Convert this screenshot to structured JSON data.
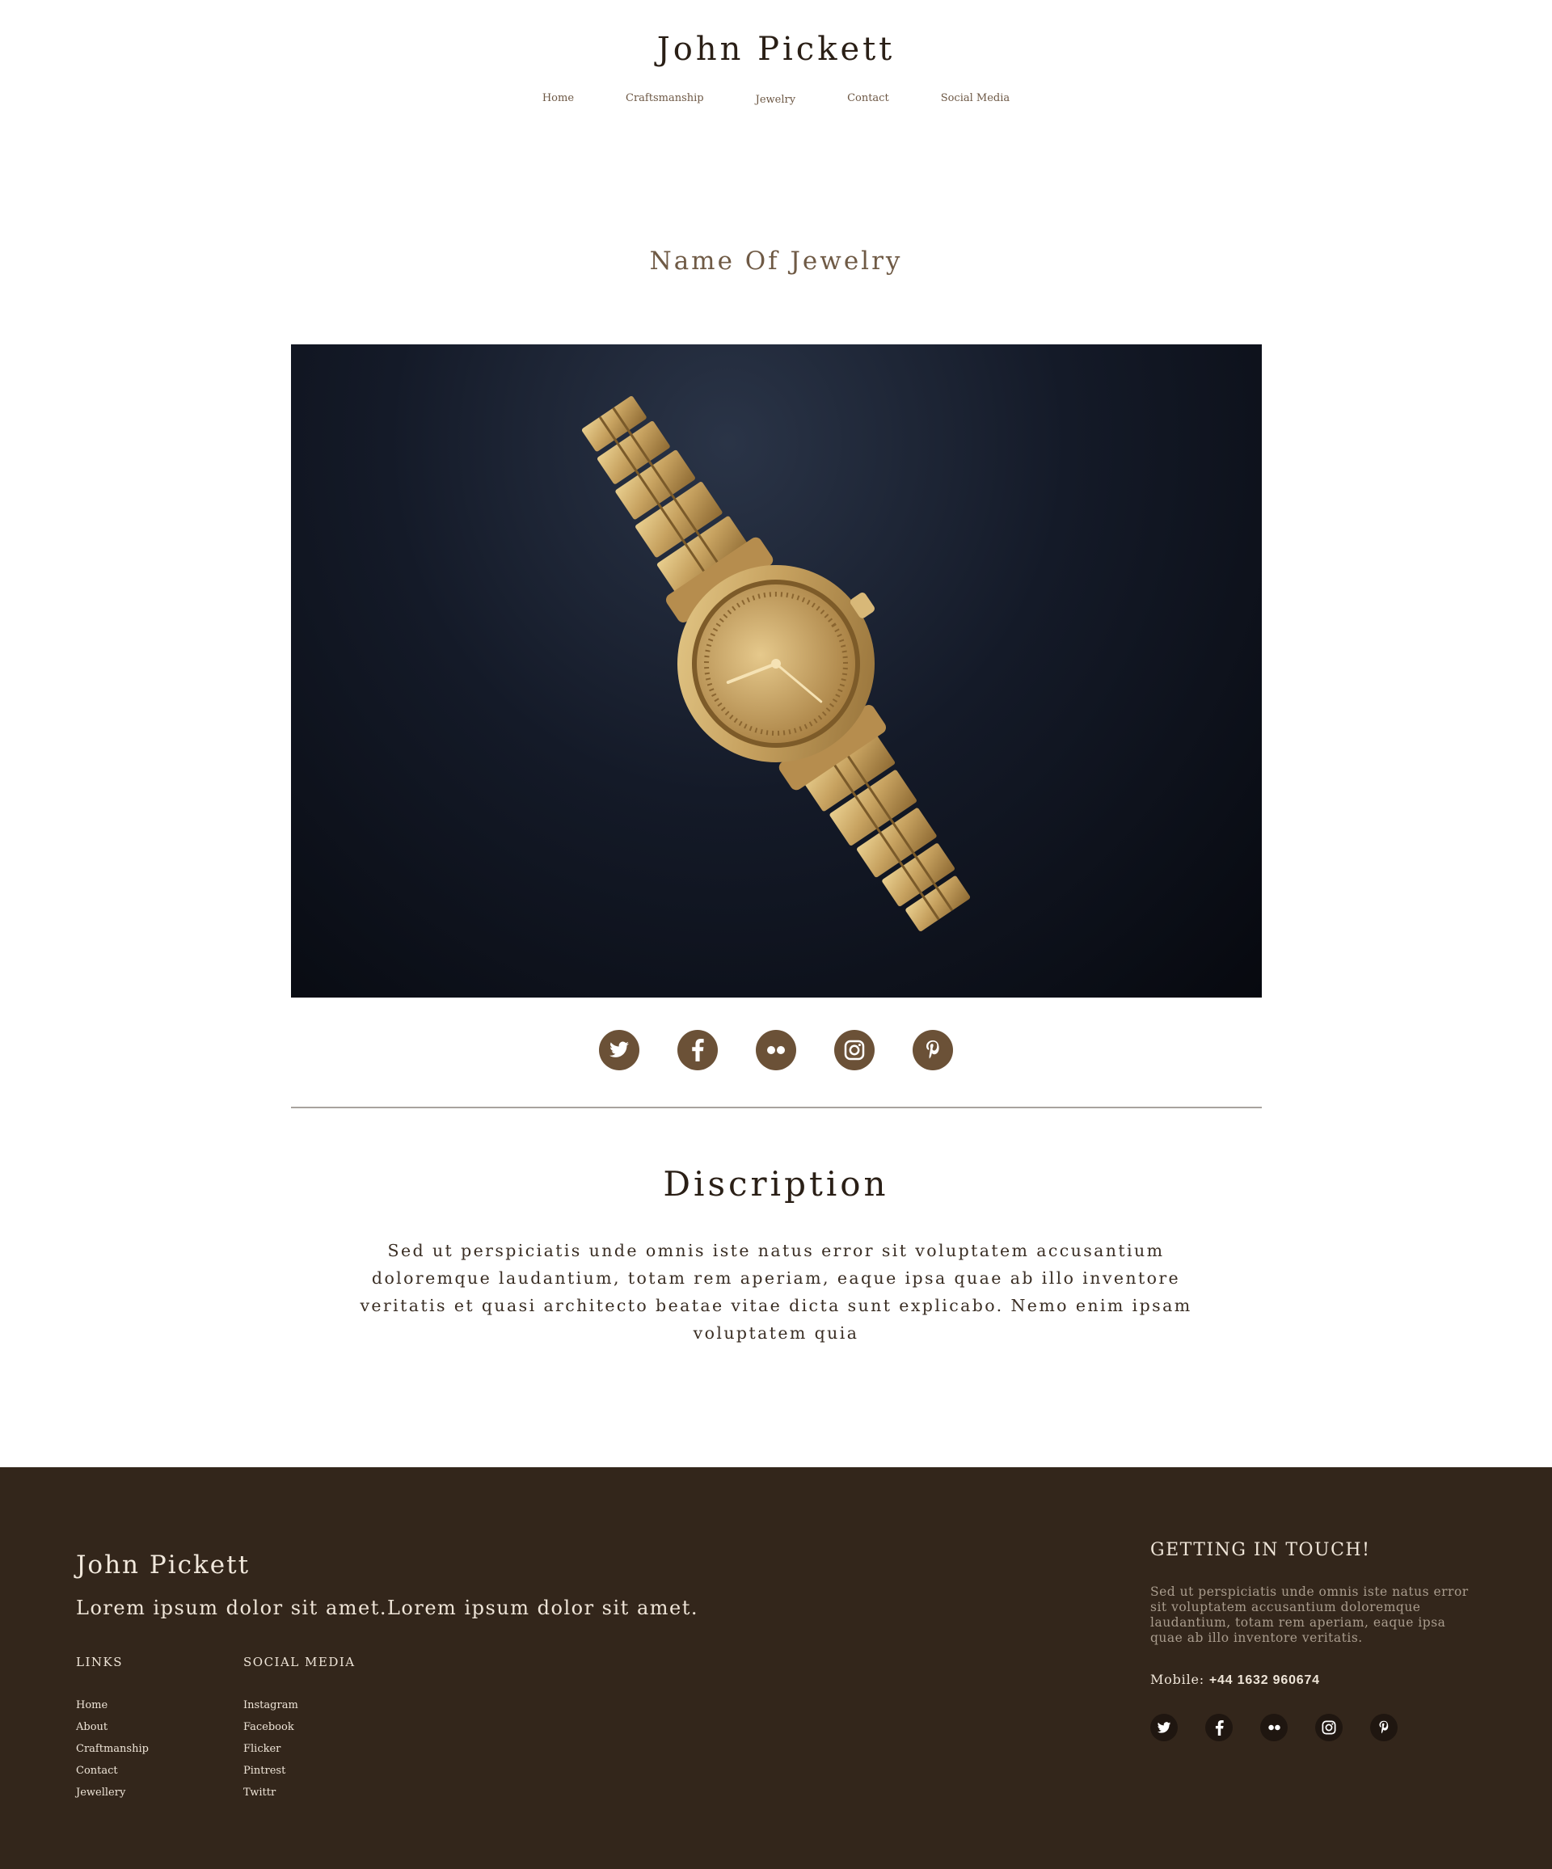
{
  "header": {
    "title": "John Pickett",
    "nav": [
      "Home",
      "Craftsmanship",
      "Jewelry",
      "Contact",
      "Social Media"
    ]
  },
  "product": {
    "name": "Name Of Jewelry",
    "share_icons": [
      "twitter-icon",
      "facebook-icon",
      "flickr-icon",
      "instagram-icon",
      "pinterest-icon"
    ]
  },
  "description": {
    "title": "Discription",
    "text": "Sed ut perspiciatis unde omnis iste natus error sit voluptatem accusantium doloremque laudantium, totam rem aperiam, eaque ipsa quae ab illo inventore veritatis et quasi architecto beatae vitae dicta sunt explicabo. Nemo enim ipsam voluptatem quia"
  },
  "footer": {
    "brand": "John Pickett",
    "tagline": "Lorem ipsum dolor sit amet.Lorem ipsum dolor sit amet.",
    "links_title": "LINKS",
    "links": [
      "Home",
      "About",
      "Craftmanship",
      "Contact",
      "Jewellery"
    ],
    "social_title": "SOCIAL MEDIA",
    "social_links": [
      "Instagram",
      "Facebook",
      "Flicker",
      "Pintrest",
      "Twittr"
    ],
    "contact_title": "GETTING IN TOUCH!",
    "contact_text": "Sed ut perspiciatis unde omnis iste natus error sit voluptatem accusantium doloremque laudantium, totam rem aperiam, eaque ipsa quae ab illo inventore veritatis.",
    "mobile_label": "Mobile:",
    "mobile_number": "+44 1632 960674"
  },
  "colors": {
    "accent_brown": "#6b5137",
    "footer_bg": "#33261b",
    "heading_brown": "#6f5a45"
  }
}
